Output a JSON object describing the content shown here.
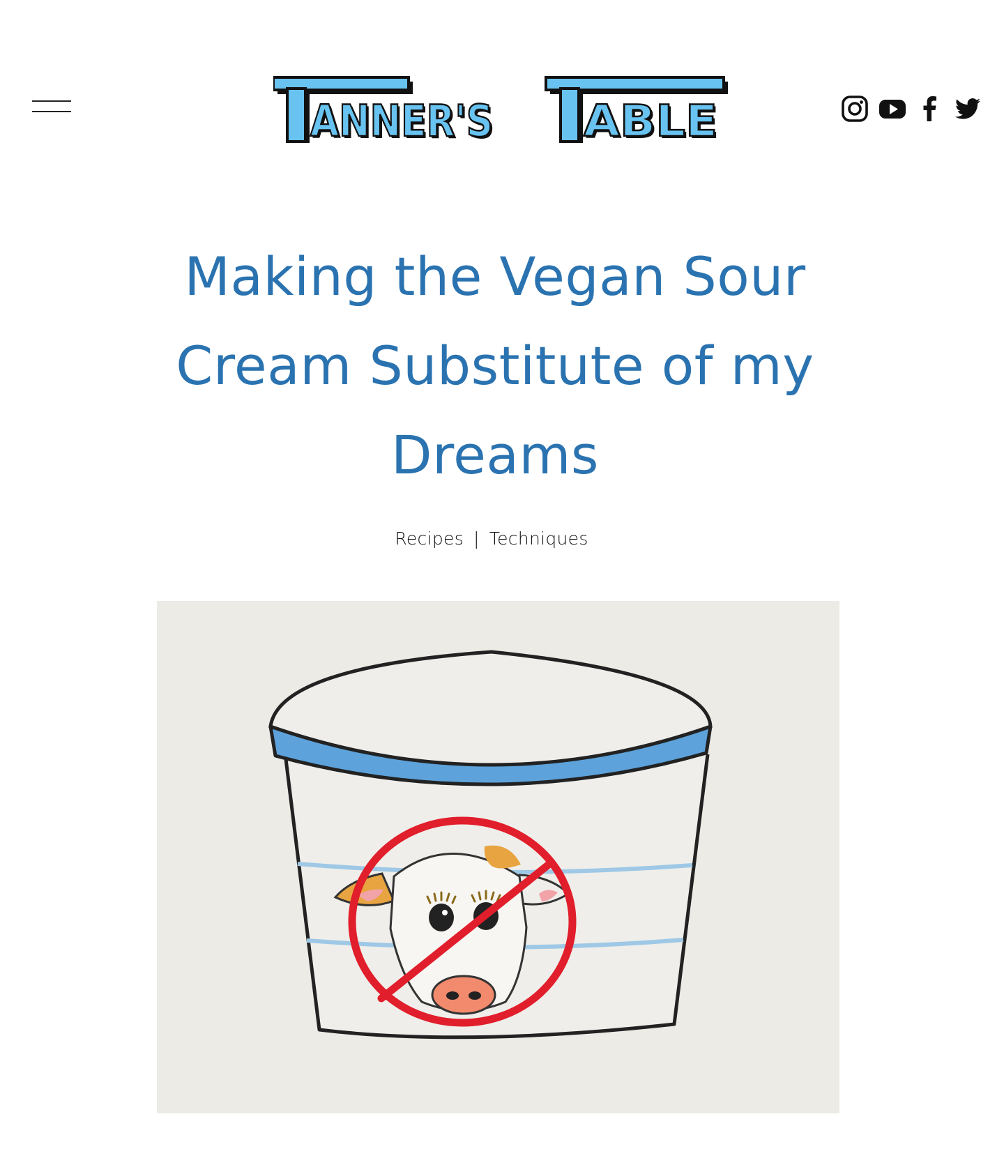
{
  "header": {
    "menu_icon": "hamburger-menu-icon",
    "logo_text": "TANNER'S TABLE",
    "social_icons": [
      "instagram-icon",
      "youtube-icon",
      "facebook-icon",
      "twitter-icon"
    ]
  },
  "post": {
    "title": "Making the Vegan Sour Cream Substitute of my Dreams",
    "categories": [
      "Recipes",
      "Techniques"
    ],
    "separator": "|"
  },
  "colors": {
    "title": "#2a73b0",
    "logo_fill": "#68c3f0",
    "tub_lid": "#5da2da",
    "no_sign": "#e11e2b"
  }
}
